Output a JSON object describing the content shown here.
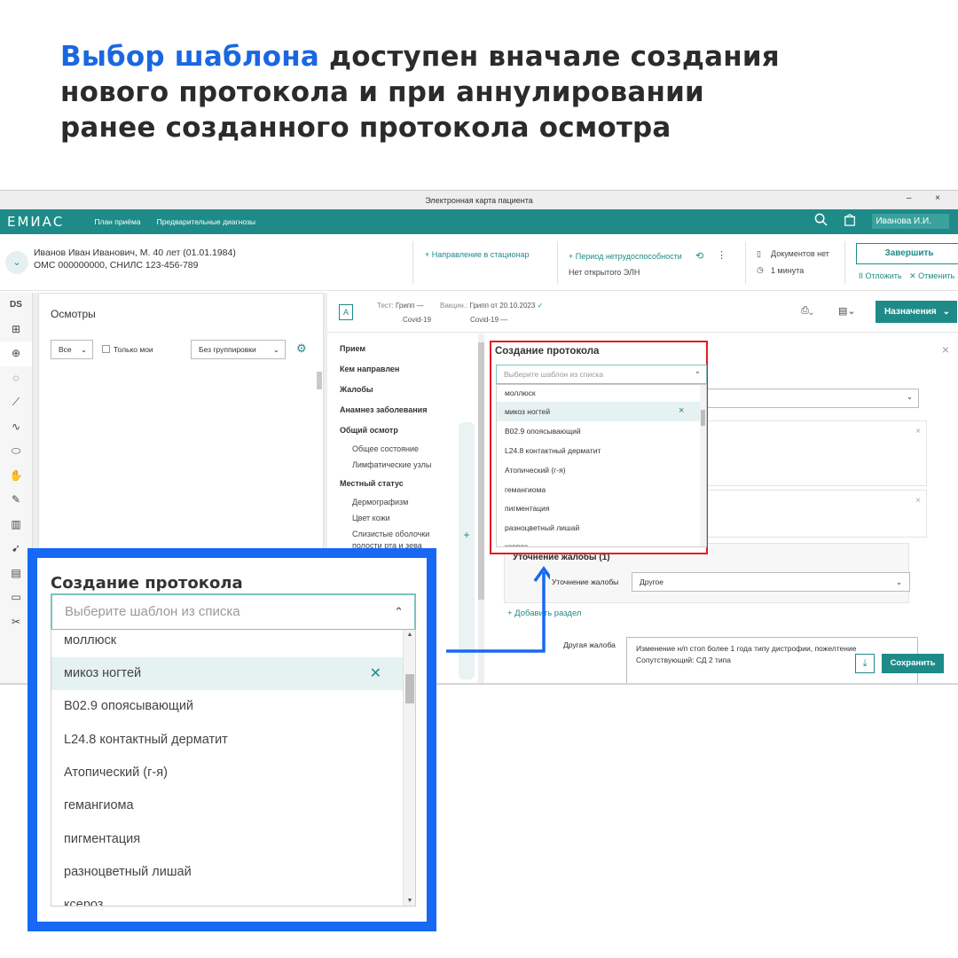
{
  "headline": {
    "highlight": "Выбор шаблона",
    "line1_rest": " доступен вначале создания",
    "line2": "нового протокола и при аннулировании",
    "line3": "ранее созданного протокола осмотра"
  },
  "window": {
    "title": "Электронная карта пациента",
    "controls": "– ×"
  },
  "topnav": {
    "logo": "ЕМИАС",
    "links": [
      "План приёма",
      "Предварительные диагнозы"
    ],
    "user": "Иванова И.И.",
    "icons": [
      "search-icon",
      "building-icon"
    ]
  },
  "patient": {
    "name": "Иванов Иван Иванович, М. 40 лет (01.01.1984)",
    "ids": "ОМС 000000000, СНИЛС 123-456-789",
    "action_hosp": "+ Направление в стационар",
    "action_period": "+ Период нетрудоспособности",
    "eln": "Нет открытого ЭЛН",
    "docs": "Документов нет",
    "time": "1 минута",
    "finish": "Завершить",
    "postpone": "II Отложить",
    "cancel": "✕ Отменить"
  },
  "leftbar": {
    "top_label": "DS"
  },
  "exams_panel": {
    "title": "Осмотры",
    "filter_all": "Все",
    "only_mine": "Только мои",
    "grouping": "Без группировки"
  },
  "main_header": {
    "test_label": "Тест:",
    "test_value": "Грипп —",
    "test_sub": "Covid-19",
    "vacc_label": "Вакцин.:",
    "vacc_value": "Грипп от 20.10.2023",
    "vacc_sub": "Covid-19 —",
    "assign": "Назначения"
  },
  "toc": {
    "items": [
      "Прием",
      "Кем направлен",
      "Жалобы",
      "Анамнез заболевания",
      "Общий осмотр"
    ],
    "general_sub": [
      "Общее состояние",
      "Лимфатические узлы"
    ],
    "local": "Местный статус",
    "local_sub": [
      "Дермографизм",
      "Цвет кожи",
      "Слизистые оболочки",
      "полости рта и зева"
    ]
  },
  "protocol": {
    "title": "Создание протокола",
    "placeholder": "Выберите шаблон из списка",
    "templates": [
      "моллюск",
      "микоз ногтей",
      "B02.9 опоясывающий",
      "L24.8 контактный дерматит",
      "Атопический (г-я)",
      "гемангиома",
      "пигментация",
      "разноцветный лишай",
      "ксероз"
    ],
    "selected_index": 1
  },
  "form": {
    "clarify_title": "Уточнение жалобы (1)",
    "clarify_label": "Уточнение жалобы",
    "clarify_value": "Другое",
    "add_section": "+ Добавить раздел",
    "other_label": "Другая жалоба",
    "other_text_1": "Изменение н/п стоп более 1 года типу дистрофии, пожелтение",
    "other_text_2": "Сопутствующий: СД 2 типа",
    "save": "Сохранить"
  },
  "colors": {
    "accent": "#1e8b88",
    "highlight_blue": "#1b67e0",
    "frame_blue": "#1668f5",
    "frame_red": "#e31b23"
  }
}
